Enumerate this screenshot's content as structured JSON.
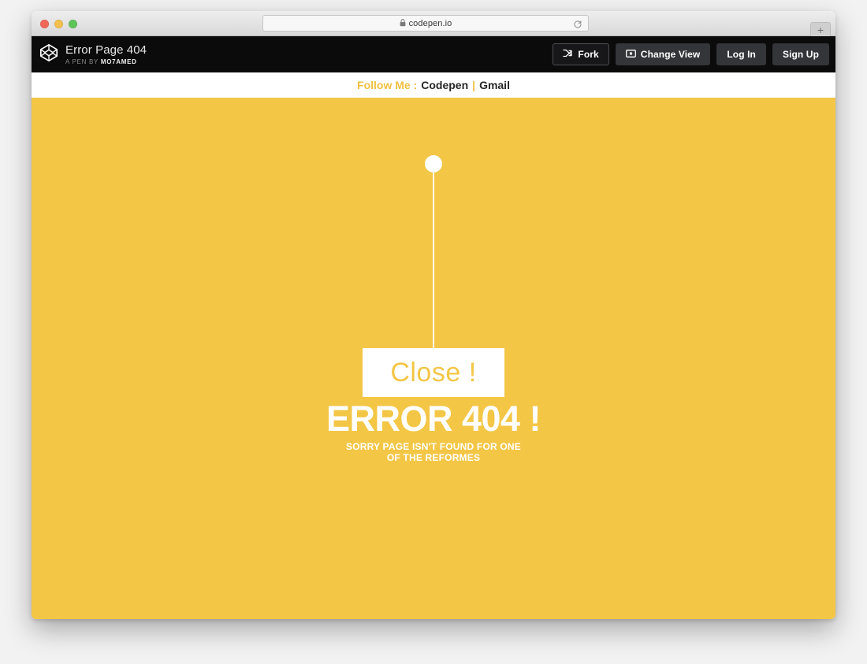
{
  "browser": {
    "traffic_lights": [
      {
        "name": "close",
        "color": "#f0675a"
      },
      {
        "name": "minimize",
        "color": "#f5bf4f"
      },
      {
        "name": "zoom",
        "color": "#5ec45a"
      }
    ],
    "url": "codepen.io",
    "lock_icon": "lock-icon",
    "reload_icon": "reload-icon",
    "new_tab_label": "+"
  },
  "pen_header": {
    "logo_icon": "codepen-logo-icon",
    "title": "Error Page 404",
    "byline_prefix": "A PEN BY",
    "author": "MO7AMED",
    "actions": [
      {
        "label": "Fork",
        "icon": "fork-icon",
        "style": "outlined"
      },
      {
        "label": "Change View",
        "icon": "change-view-icon",
        "style": "filled"
      },
      {
        "label": "Log In",
        "icon": "",
        "style": "filled"
      },
      {
        "label": "Sign Up",
        "icon": "",
        "style": "filled"
      }
    ]
  },
  "follow_bar": {
    "label": "Follow Me :",
    "links": [
      {
        "text": "Codepen"
      },
      {
        "text": "Gmail"
      }
    ],
    "separator": "|"
  },
  "stage": {
    "background_color": "#f3c646",
    "knob_color": "#ffffff",
    "string_color": "#fdfaf0",
    "close_label": "Close !",
    "close_text_color": "#f3c646",
    "error_code": "ERROR 404 !",
    "error_message": "SORRY PAGE ISN'T FOUND FOR ONE OF THE REFORMES",
    "text_color": "#ffffff"
  }
}
